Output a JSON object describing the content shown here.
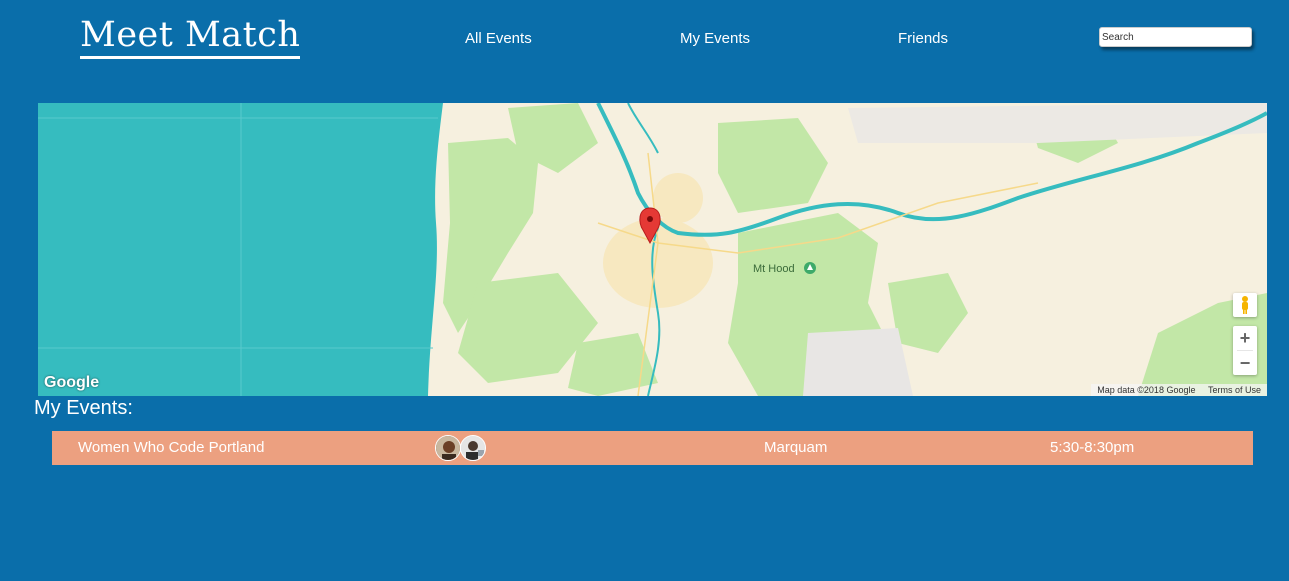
{
  "header": {
    "logo": "Meet Match",
    "nav": [
      "All Events",
      "My Events",
      "Friends"
    ],
    "search_placeholder": "Search"
  },
  "map": {
    "place_label": "Mt Hood",
    "provider_logo": "Google",
    "attribution": "Map data ©2018 Google",
    "terms": "Terms of Use",
    "zoom_in": "+",
    "zoom_out": "−",
    "colors": {
      "water": "#36bcbf",
      "land": "#f6f0df",
      "parks": "#c2e7a7",
      "marker": "#e53935"
    }
  },
  "events": {
    "title": "My Events:",
    "rows": [
      {
        "name": "Women Who Code Portland",
        "location": "Marquam",
        "time": "5:30-8:30pm"
      }
    ]
  },
  "colors": {
    "background": "#0a6eaa",
    "row": "#eca080"
  }
}
